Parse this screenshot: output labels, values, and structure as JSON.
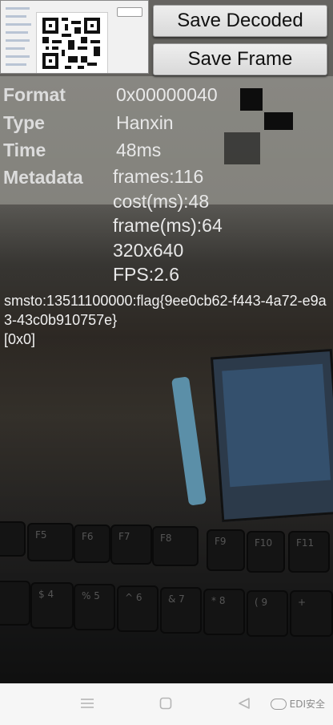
{
  "buttons": {
    "save_decoded": "Save Decoded",
    "save_frame": "Save Frame"
  },
  "info": {
    "format_label": "Format",
    "format_value": "0x00000040",
    "type_label": "Type",
    "type_value": "Hanxin",
    "time_label": "Time",
    "time_value": "48ms",
    "metadata_label": "Metadata",
    "metadata_lines": [
      "frames:116",
      "cost(ms):48",
      "frame(ms):64",
      "320x640",
      "FPS:2.6"
    ]
  },
  "result": {
    "text": "smsto:13511100000:flag{9ee0cb62-f443-4a72-e9a3-43c0b910757e}",
    "coords": "[0x0]"
  },
  "navbar": {
    "menu_icon": "menu-icon",
    "home_icon": "home-icon",
    "back_icon": "back-icon",
    "watermark": "EDI安全"
  },
  "colors": {
    "button_bg": "#e3e3e3",
    "text": "#e8e8e8",
    "navbar_bg": "#f6f6f6"
  }
}
